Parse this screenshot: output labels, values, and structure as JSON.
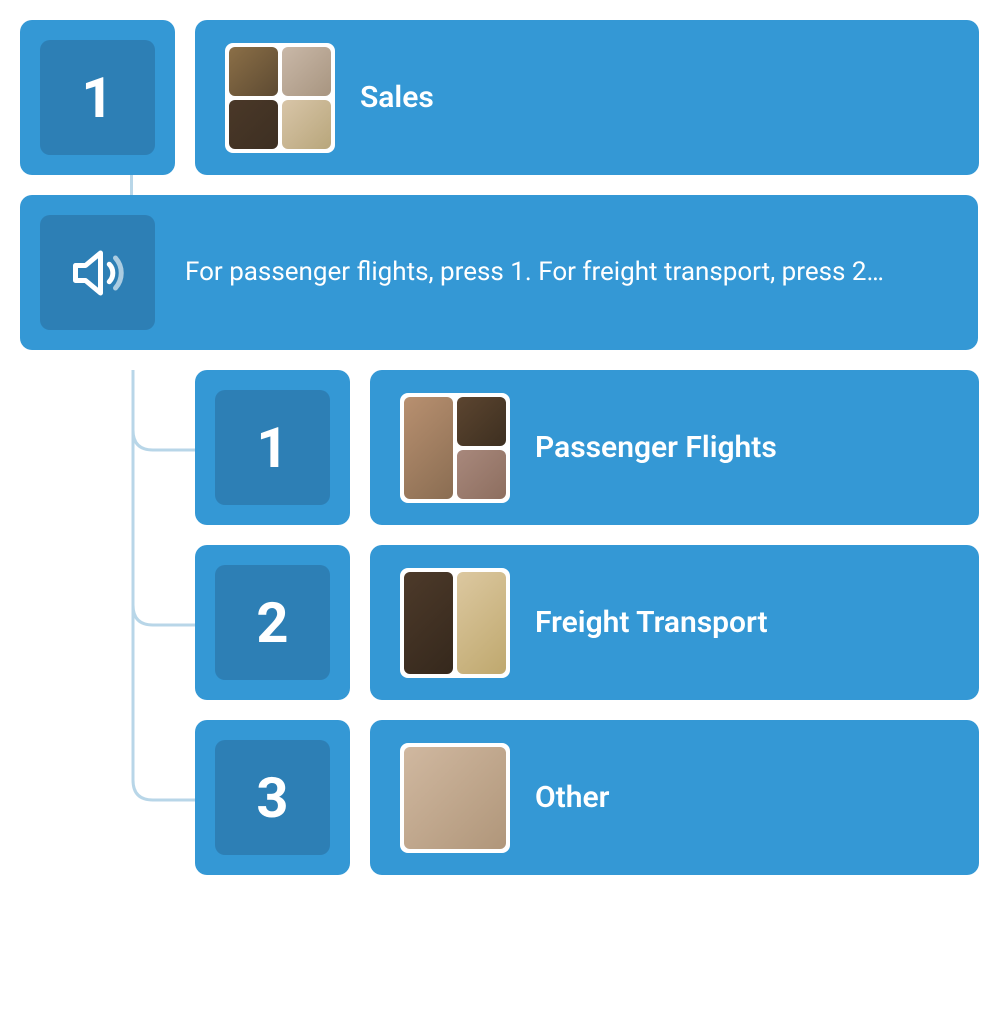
{
  "root_option": {
    "number": "1",
    "label": "Sales"
  },
  "prompt": {
    "text": "For passenger flights, press 1. For freight transport, press 2…"
  },
  "child_options": [
    {
      "number": "1",
      "label": "Passenger Flights"
    },
    {
      "number": "2",
      "label": "Freight Transport"
    },
    {
      "number": "3",
      "label": "Other"
    }
  ],
  "colors": {
    "primary": "#3498d5",
    "primary_dark": "#2d7fb5",
    "connector": "#b8d6e8"
  }
}
